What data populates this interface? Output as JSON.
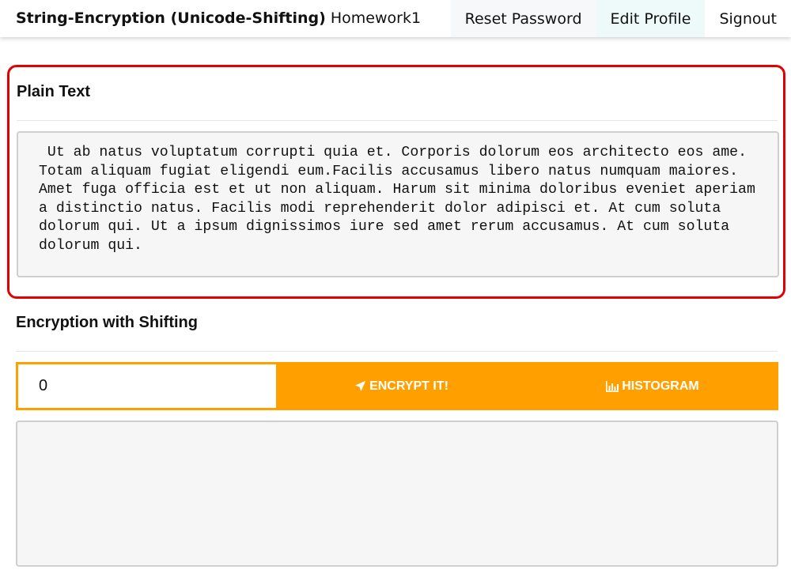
{
  "navbar": {
    "brand_title": "String-Encryption (Unicode-Shifting)",
    "brand_subtitle": "Homework1",
    "items": [
      {
        "label": "Reset Password"
      },
      {
        "label": "Edit Profile"
      },
      {
        "label": "Signout"
      }
    ]
  },
  "plain": {
    "title": "Plain Text",
    "text": " Ut ab natus voluptatum corrupti quia et. Corporis dolorum eos architecto eos ame. Totam aliquam fugiat eligendi eum.Facilis accusamus libero natus numquam maiores. Amet fuga officia est et ut non aliquam. Harum sit minima doloribus eveniet aperiam a distinctio natus. Facilis modi reprehenderit dolor adipisci et. At cum soluta dolorum qui. Ut a ipsum dignissimos iure sed amet rerum accusamus. At cum soluta dolorum qui."
  },
  "encryption": {
    "title": "Encryption with Shifting",
    "shift_value": "0",
    "encrypt_label": "ENCRYPT IT!",
    "histogram_label": "HISTOGRAM",
    "encrypt_icon": "rocket-icon",
    "histogram_icon": "bar-chart-icon",
    "output_text": ""
  },
  "colors": {
    "accent": "#ffa000",
    "highlight": "#e30000"
  }
}
